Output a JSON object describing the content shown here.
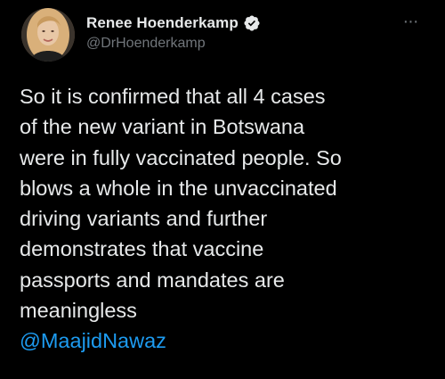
{
  "tweet": {
    "author": {
      "display_name": "Renee Hoenderkamp",
      "handle": "@DrHoenderkamp",
      "avatar_icon": "profile-photo",
      "verified_icon": "verified-badge-icon"
    },
    "more_icon": "more-options-icon",
    "more_label": "···",
    "text_lines": [
      "So it is confirmed that all 4 cases",
      "of the new variant in Botswana",
      "were in fully vaccinated people. So",
      "blows a whole in the unvaccinated",
      "driving variants and further",
      "demonstrates that vaccine",
      "passports and mandates are",
      "meaningless"
    ],
    "mention": "@MaajidNawaz"
  },
  "colors": {
    "background": "#000000",
    "text": "#e7e9ea",
    "secondary_text": "#71767b",
    "link": "#1d9bf0"
  }
}
